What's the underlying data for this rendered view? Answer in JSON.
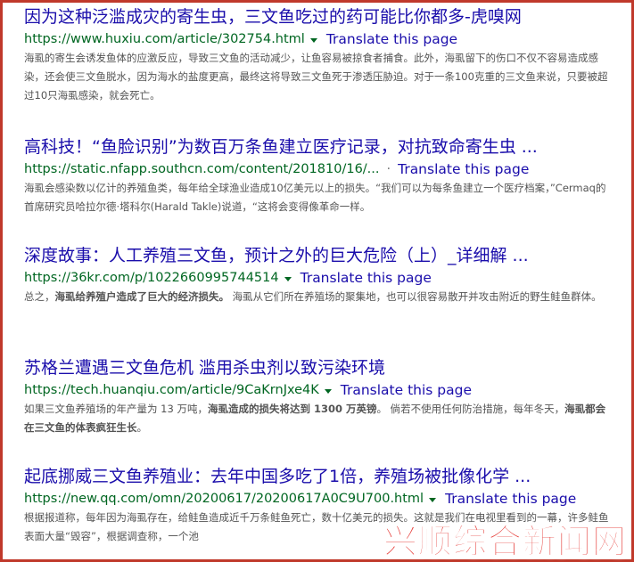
{
  "results": [
    {
      "title": "因为这种泛滥成灾的寄生虫，三文鱼吃过的药可能比你都多-虎嗅网",
      "url": "https://www.huxiu.com/article/302754.html",
      "separator": "",
      "translate": "Translate this page",
      "snippet_parts": [
        {
          "t": "海虱的寄生会诱发鱼体的应激反应，导致三文鱼的活动减少，让鱼容易被掠食者捕食。此外，海虱留下的伤口不仅不容易造成感染，还会使三文鱼脱水，因为海水的盐度更高，最终这将导致三文鱼死于渗透压胁迫。对于一条100克重的三文鱼来说，只要被超过10只海虱感染，就会死亡。",
          "b": false
        }
      ]
    },
    {
      "title": "高科技！“鱼脸识别”为数百万条鱼建立医疗记录，对抗致命寄生虫 ...",
      "url": "https://static.nfapp.southcn.com/content/201810/16/...",
      "separator": "·",
      "translate": "Translate this page",
      "snippet_parts": [
        {
          "t": "海虱会感染数以亿计的养殖鱼类，每年给全球渔业造成10亿美元以上的损失。“我们可以为每条鱼建立一个医疗档案，”Cermaq的首席研究员哈拉尔德·塔科尔(Harald Takle)说道，“这将会变得像革命一样。",
          "b": false
        }
      ]
    },
    {
      "title": "深度故事：人工养殖三文鱼，预计之外的巨大危险（上）_详细解 ...",
      "url": "https://36kr.com/p/1022660995744514",
      "separator": "",
      "translate": "Translate this page",
      "snippet_parts": [
        {
          "t": "总之，",
          "b": false
        },
        {
          "t": "海虱给养殖户造成了巨大的经济损失。",
          "b": true
        },
        {
          "t": " 海虱从它们所在养殖场的聚集地，也可以很容易散开并攻击附近的野生鲑鱼群体。",
          "b": false
        }
      ]
    },
    {
      "title": "苏格兰遭遇三文鱼危机 滥用杀虫剂以致污染环境",
      "url": "https://tech.huanqiu.com/article/9CaKrnJxe4K",
      "separator": "",
      "translate": "Translate this page",
      "snippet_parts": [
        {
          "t": "如果三文鱼养殖场的年产量为 13 万吨，",
          "b": false
        },
        {
          "t": "海虱造成的损失将达到 1300 万英镑",
          "b": true
        },
        {
          "t": "。 倘若不使用任何防治措施，每年冬天，",
          "b": false
        },
        {
          "t": "海虱都会在三文鱼的体表疯狂生长",
          "b": true
        },
        {
          "t": "。",
          "b": false
        }
      ]
    },
    {
      "title": "起底挪威三文鱼养殖业：去年中国多吃了1倍，养殖场被批像化学 ...",
      "url": "https://new.qq.com/omn/20200617/20200617A0C9U700.html",
      "separator": "",
      "translate": "Translate this page",
      "snippet_parts": [
        {
          "t": "根据报道称，每年因为海虱存在，给鲑鱼造成近千万条鲑鱼死亡，数十亿美元的损失。这就是我们在电视里看到的一幕，许多鲑鱼表面大量“毁容”，根据调查称，一个池",
          "b": false
        }
      ]
    }
  ],
  "watermark": "兴顺综合新闻网"
}
